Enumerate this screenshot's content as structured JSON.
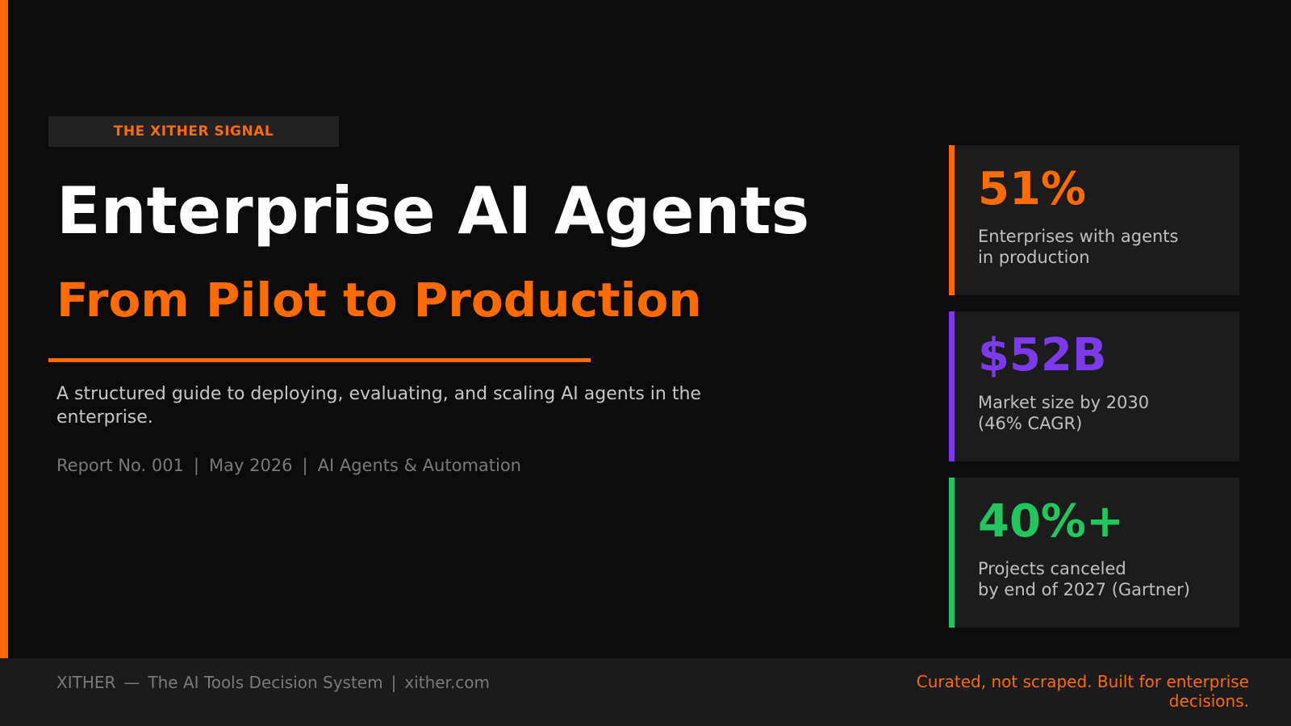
{
  "colors": {
    "accent": "#ff6b00",
    "purple": "#7c3aed",
    "green": "#22c55e",
    "background": "#0c0c0c",
    "card": "#1c1c1c"
  },
  "badge": {
    "label": "THE XITHER SIGNAL"
  },
  "hero": {
    "title": "Enterprise AI Agents",
    "subtitle": "From Pilot to Production",
    "description": "A structured guide to deploying, evaluating, and scaling AI agents in the enterprise.",
    "meta": {
      "report": "Report No. 001",
      "date": "May 2026",
      "topic": "AI Agents & Automation",
      "separator": "|"
    }
  },
  "stats": [
    {
      "value": "51%",
      "label_line1": "Enterprises with agents",
      "label_line2": "in production",
      "color": "#ff6b00"
    },
    {
      "value": "$52B",
      "label_line1": "Market size by 2030",
      "label_line2": "(46% CAGR)",
      "color": "#7c3aed"
    },
    {
      "value": "40%+",
      "label_line1": "Projects canceled",
      "label_line2": "by end of 2027 (Gartner)",
      "color": "#22c55e"
    }
  ],
  "footer": {
    "brand": "XITHER",
    "dash": "—",
    "tagline": "The AI Tools Decision System",
    "separator": "|",
    "url": "xither.com",
    "right_text": "Curated, not scraped. Built for enterprise decisions."
  }
}
